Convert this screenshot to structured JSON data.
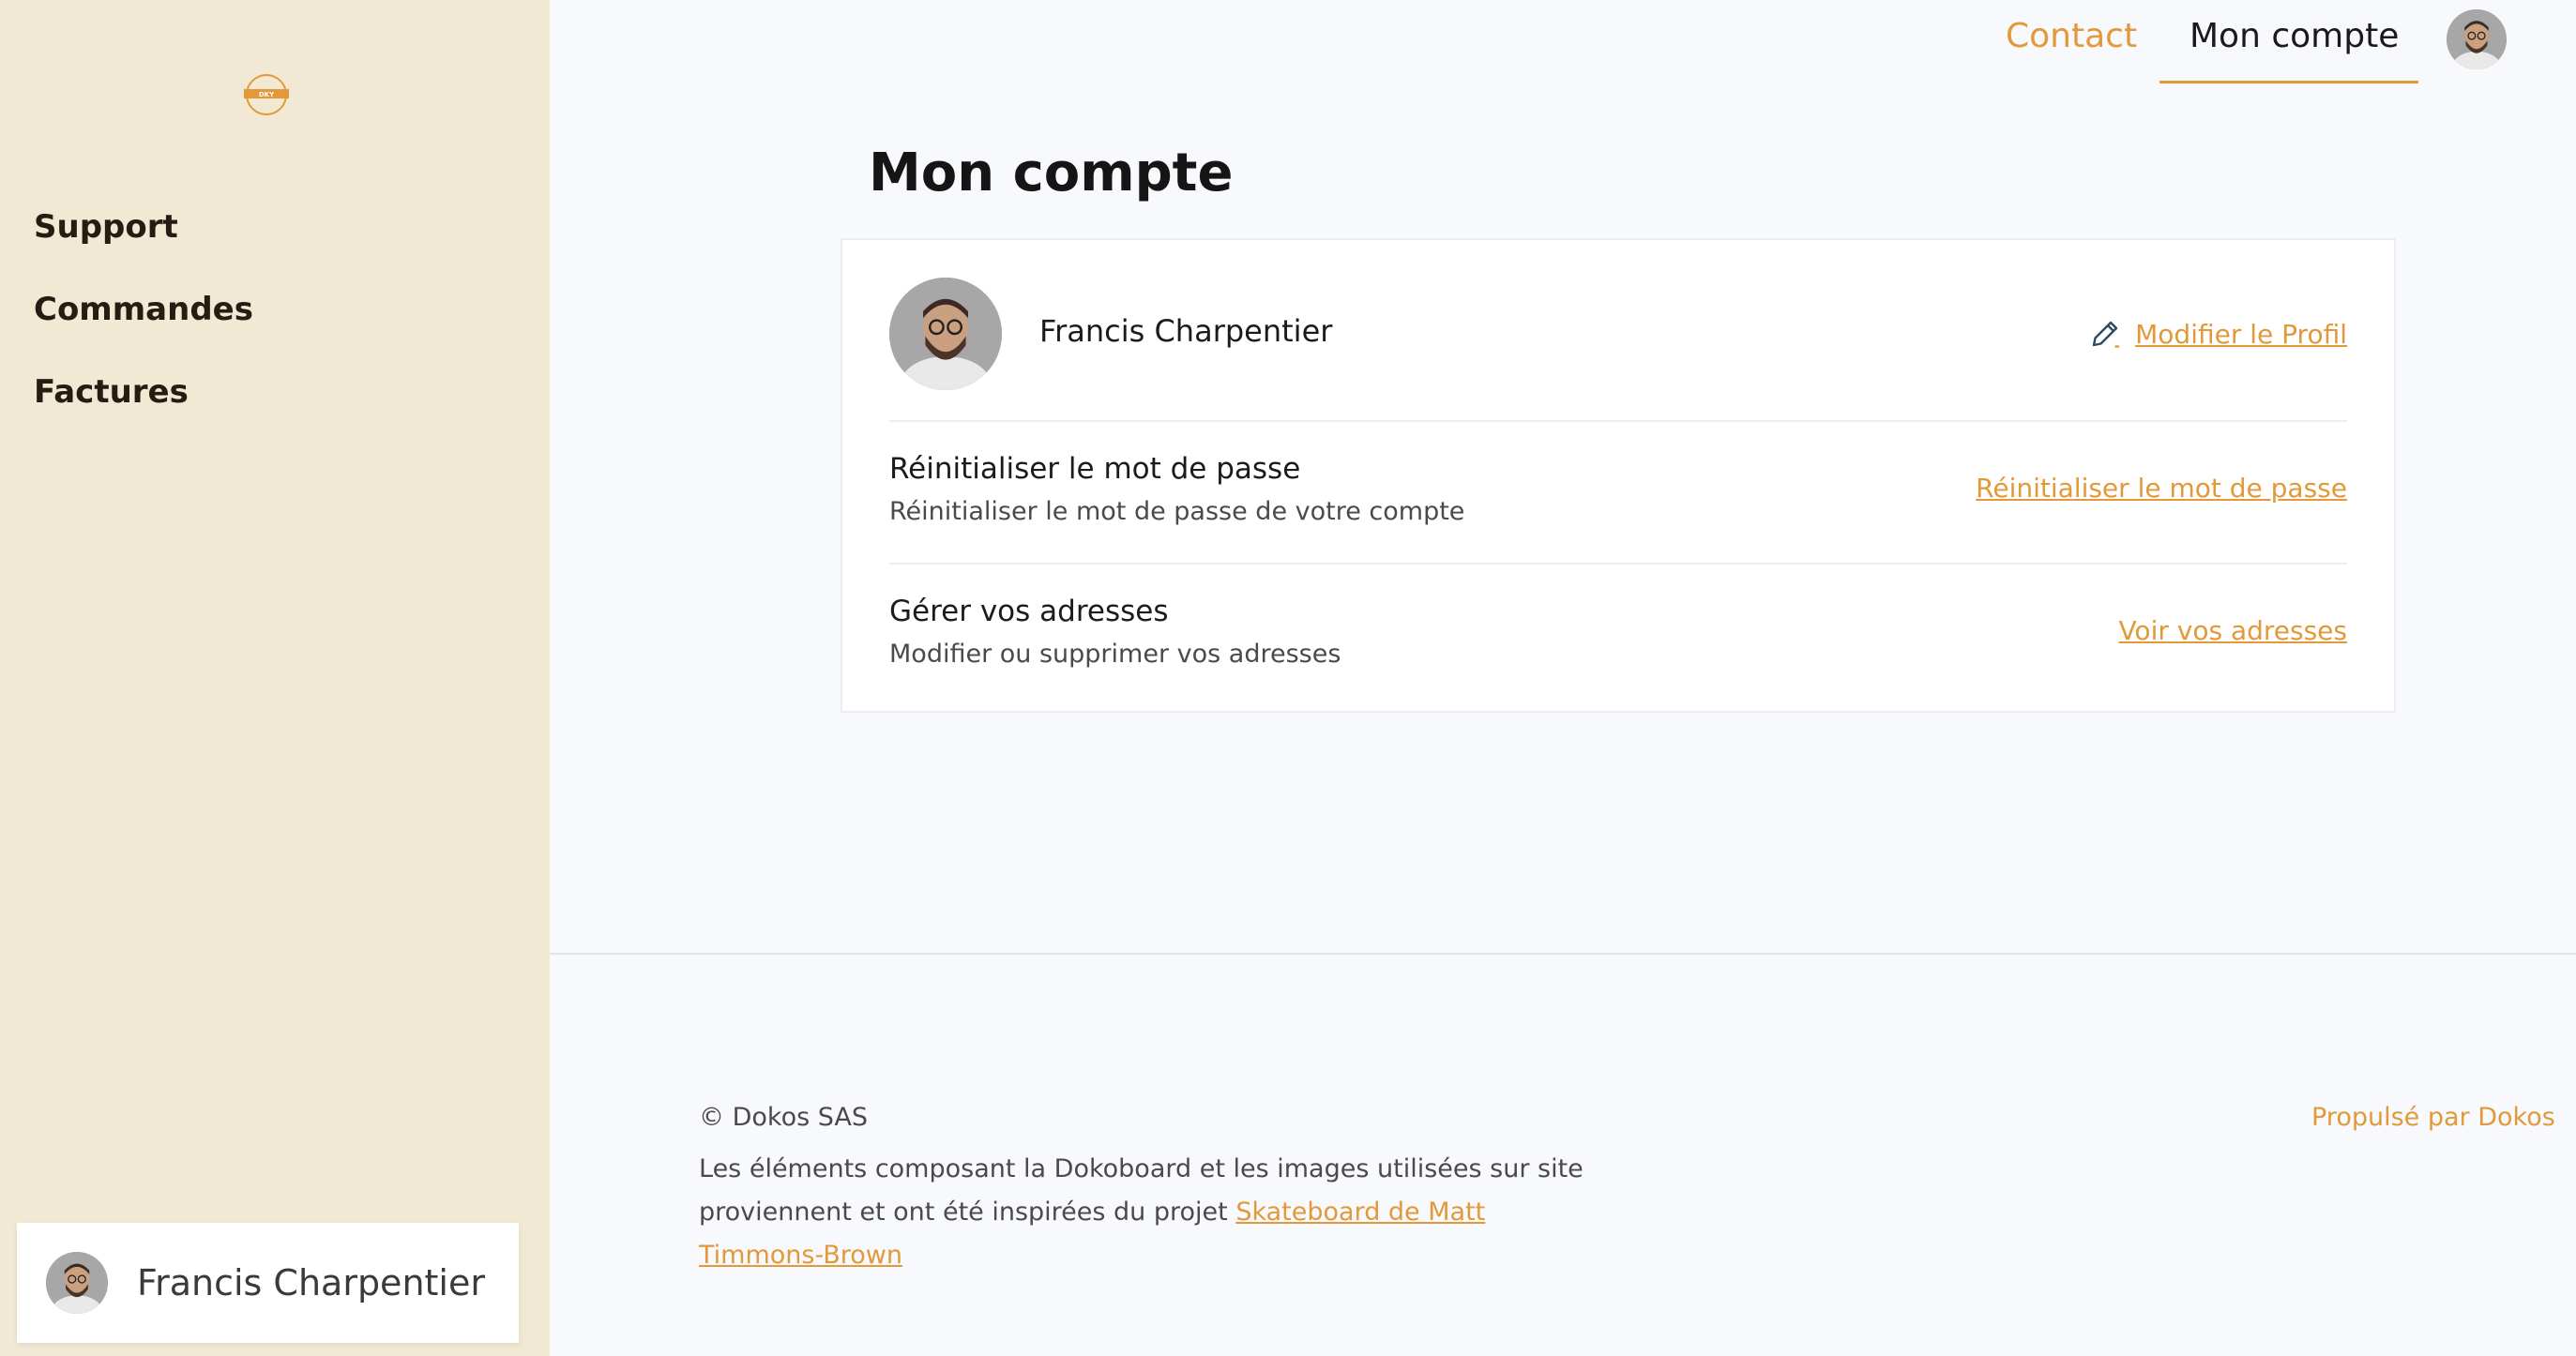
{
  "sidebar": {
    "logo_text": "DKY",
    "items": [
      {
        "label": "Support"
      },
      {
        "label": "Commandes"
      },
      {
        "label": "Factures"
      }
    ],
    "user_name": "Francis Charpentier"
  },
  "topbar": {
    "contact_label": "Contact",
    "account_label": "Mon compte"
  },
  "main": {
    "title": "Mon compte",
    "profile": {
      "name": "Francis Charpentier",
      "edit_label": "Modifier le Profil"
    },
    "password": {
      "title": "Réinitialiser le mot de passe",
      "subtitle": "Réinitialiser le mot de passe de votre compte",
      "link_label": "Réinitialiser le mot de passe"
    },
    "addresses": {
      "title": "Gérer vos adresses",
      "subtitle": "Modifier ou supprimer vos adresses",
      "link_label": "Voir vos adresses"
    }
  },
  "footer": {
    "copyright": "© Dokos SAS",
    "text_prefix": "Les éléments composant la Dokoboard et les images utilisées sur site proviennent et ont été inspirées du projet ",
    "text_link": "Skateboard de Matt Timmons-Brown",
    "powered_by": "Propulsé par Dokos"
  },
  "colors": {
    "accent": "#e1993a",
    "sidebar_bg": "#f1e9d4",
    "page_bg": "#f8f9fc"
  }
}
